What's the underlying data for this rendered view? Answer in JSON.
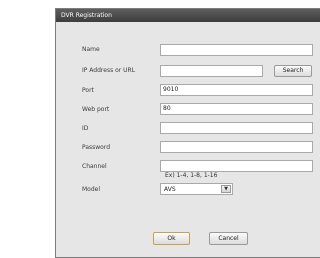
{
  "dialog": {
    "title": "DVR Registration",
    "name_label": "Name",
    "name_value": "",
    "ip_label": "IP Address or URL",
    "ip_value": "",
    "search_label": "Search",
    "port_label": "Port",
    "port_value": "9010",
    "webport_label": "Web port",
    "webport_value": "80",
    "id_label": "ID",
    "id_value": "",
    "password_label": "Password",
    "password_value": "",
    "channel_label": "Channel",
    "channel_value": "",
    "channel_hint": "Ex) 1-4, 1-8, 1-16",
    "model_label": "Model",
    "model_value": "AVS",
    "ok_label": "Ok",
    "cancel_label": "Cancel"
  }
}
